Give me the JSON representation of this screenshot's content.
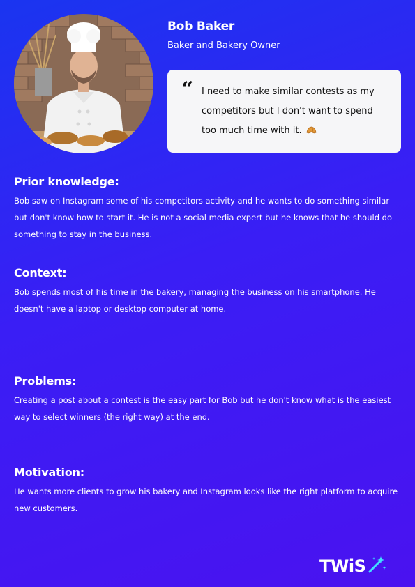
{
  "profile": {
    "name": "Bob Baker",
    "role": "Baker and Bakery Owner",
    "quote": "I need to make similar contests as my competitors but I don't want to spend too much time with it.",
    "quote_mark": "“",
    "quote_emoji_icon": "croissant-icon"
  },
  "sections": {
    "prior_knowledge": {
      "heading": "Prior knowledge:",
      "body": "Bob saw on Instagram some of his competitors activity and he wants to do something similar but don't know how to start it. He is not a social media expert but he knows that he should do something to stay in the business."
    },
    "context": {
      "heading": "Context:",
      "body": "Bob spends most of his time in the bakery, managing the business on his smartphone. He doesn't have a laptop or desktop computer at home."
    },
    "problems": {
      "heading": "Problems:",
      "body": "Creating a post about a contest is the easy part for Bob but he don't know what is the easiest way to select winners (the right way) at the end."
    },
    "motivation": {
      "heading": "Motivation:",
      "body": "He wants more clients to grow his bakery and Instagram looks like the right platform to acquire new customers."
    }
  },
  "brand": {
    "logo_text": "TWiS",
    "logo_icon": "magic-wand-icon",
    "accent_color": "#2a2af5",
    "wand_color": "#40e0ff"
  }
}
